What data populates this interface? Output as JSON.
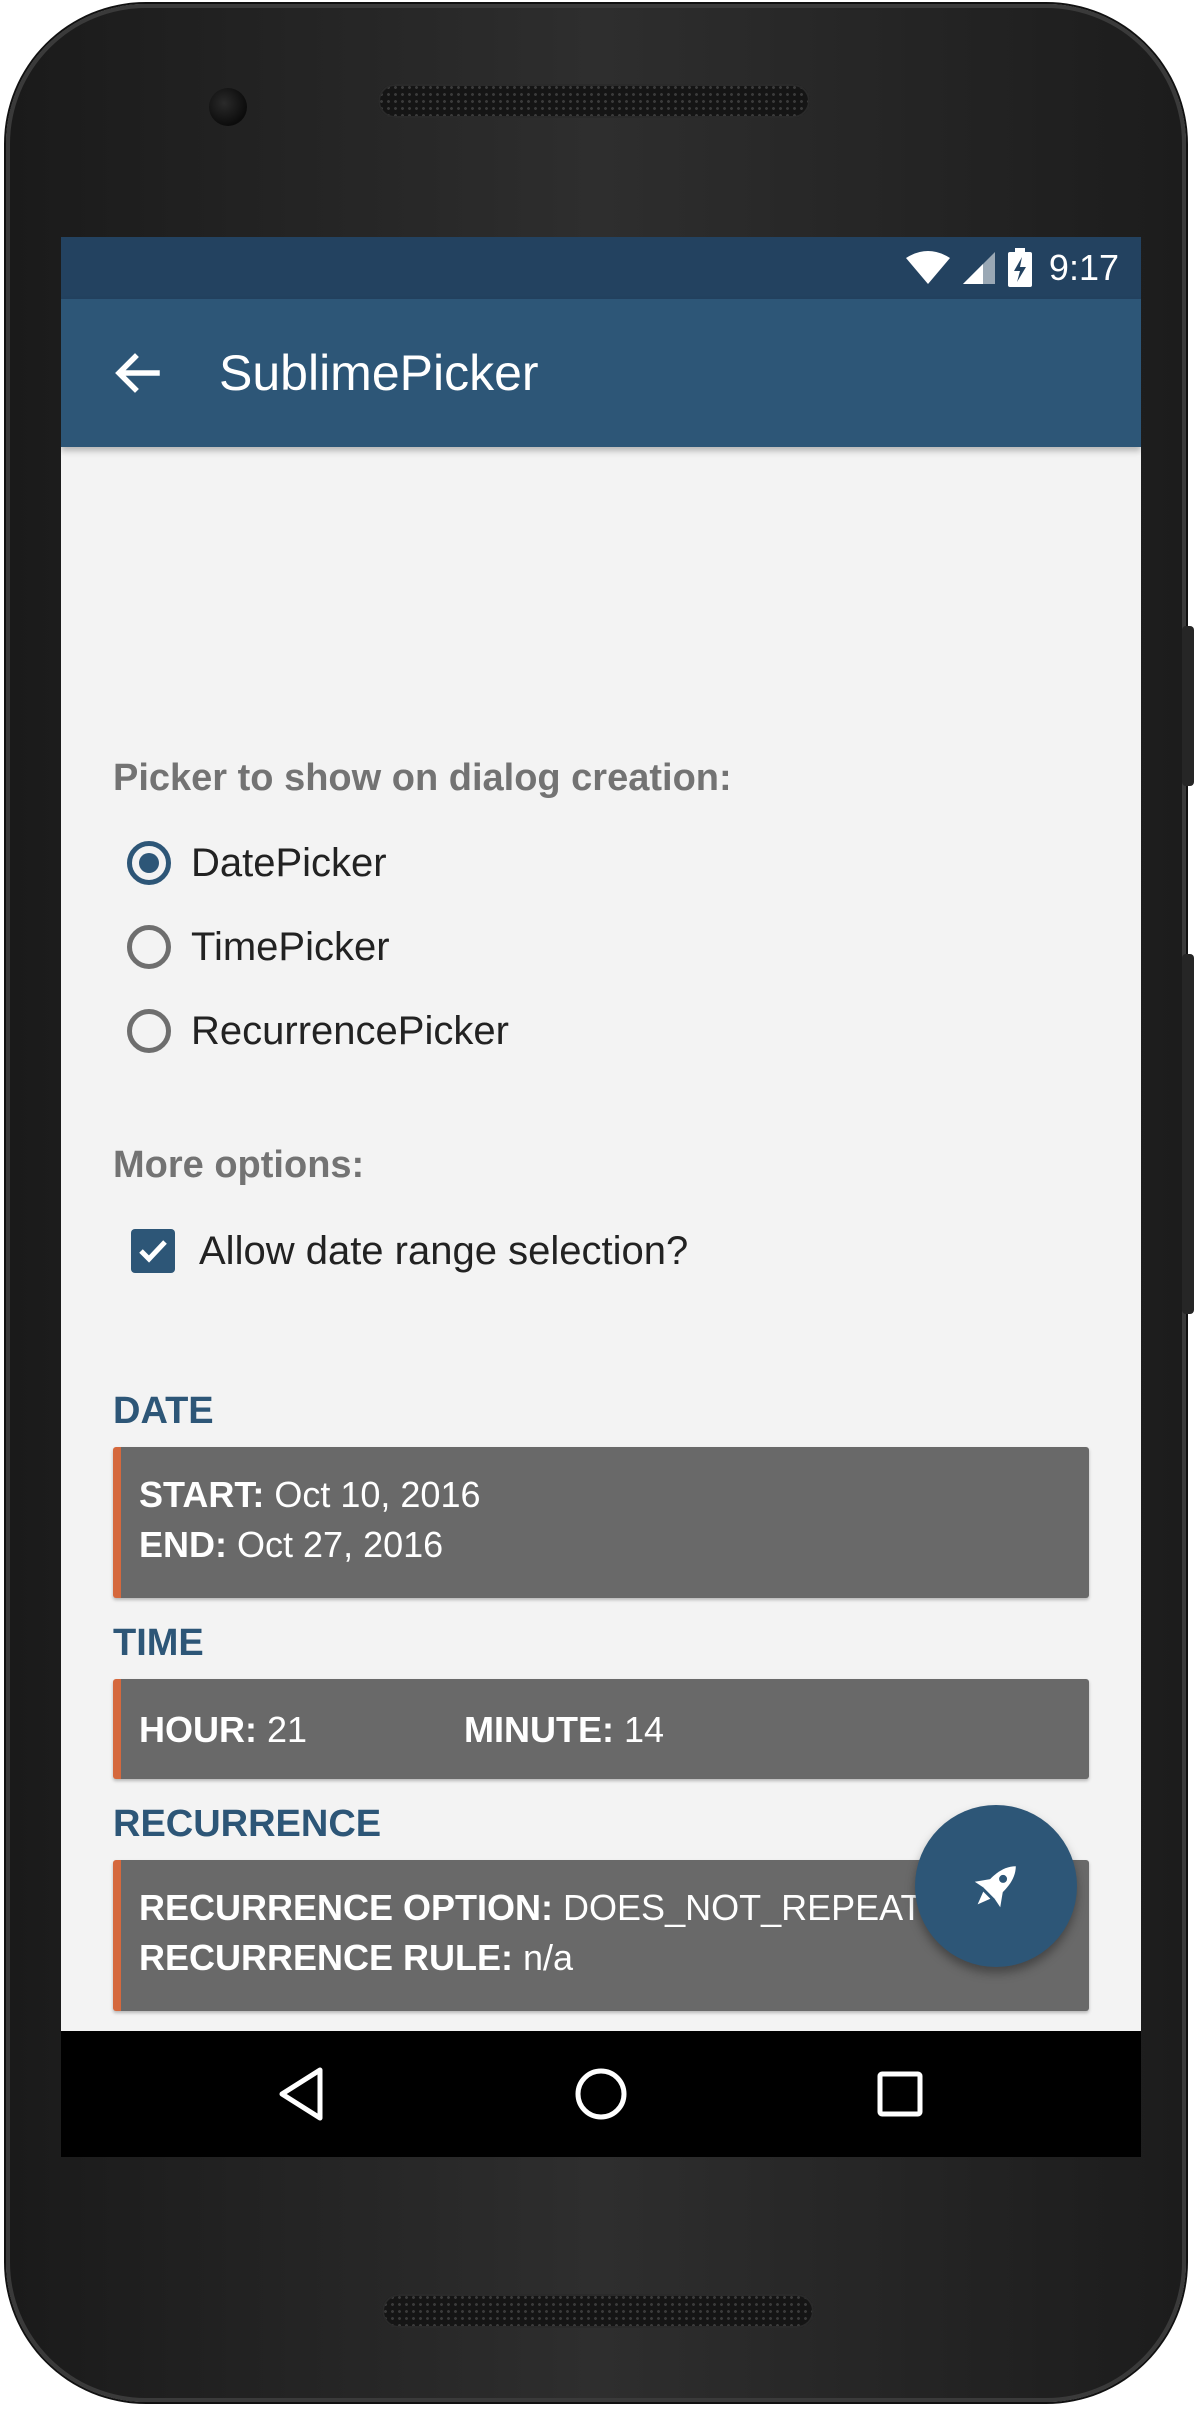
{
  "status_bar": {
    "time": "9:17"
  },
  "app_bar": {
    "title": "SublimePicker"
  },
  "picker_section": {
    "label": "Picker to show on dialog creation:",
    "options": [
      {
        "label": "DatePicker",
        "selected": true
      },
      {
        "label": "TimePicker",
        "selected": false
      },
      {
        "label": "RecurrencePicker",
        "selected": false
      }
    ]
  },
  "more_options": {
    "label": "More options:",
    "allow_range_label": "Allow date range selection?",
    "allow_range_checked": true
  },
  "date": {
    "heading": "DATE",
    "start_key": "START:",
    "start_value": "Oct 10, 2016",
    "end_key": "END:",
    "end_value": "Oct 27, 2016"
  },
  "time": {
    "heading": "TIME",
    "hour_key": "HOUR:",
    "hour_value": "21",
    "minute_key": "MINUTE:",
    "minute_value": "14"
  },
  "recurrence": {
    "heading": "RECURRENCE",
    "option_key": "RECURRENCE OPTION:",
    "option_value": "DOES_NOT_REPEAT",
    "rule_key": "RECURRENCE RULE:",
    "rule_value": "n/a"
  },
  "fab": {
    "icon": "rocket-icon"
  },
  "nav": {
    "icons": [
      "back-triangle-icon",
      "home-circle-icon",
      "recents-square-icon"
    ]
  },
  "colors": {
    "primary": "#2d5677",
    "primary_dark": "#234260",
    "accent": "#d5683d",
    "card": "#696969",
    "background": "#f3f3f3"
  }
}
